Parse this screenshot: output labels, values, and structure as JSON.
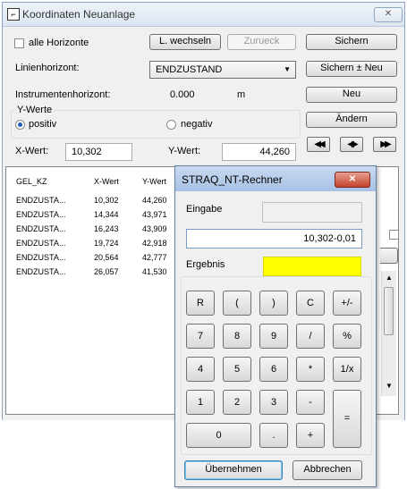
{
  "main": {
    "title": "Koordinaten Neuanlage",
    "close_icon": "✕",
    "alle_horizonte": "alle Horizonte",
    "l_wechseln": "L. wechseln",
    "zurueck": "Zurueck",
    "sichern": "Sichern",
    "linienhorizont_label": "Linienhorizont:",
    "linienhorizont_value": "ENDZUSTAND",
    "sichern_neu": "Sichern ± Neu",
    "instrumentenhorizont_label": "Instrumentenhorizont:",
    "instrumentenhorizont_value": "0.000",
    "instrumentenhorizont_unit": "m",
    "neu": "Neu",
    "y_werte": "Y-Werte",
    "positiv": "positiv",
    "negativ": "negativ",
    "aendern": "Ändern",
    "x_wert_label": "X-Wert:",
    "x_wert_value": "10,302",
    "y_wert_label": "Y-Wert:",
    "y_wert_value": "44,260",
    "nav_first": "◀◀",
    "nav_mid": "◀▶",
    "nav_last": "▶▶"
  },
  "table": {
    "headers": [
      "GEL_KZ",
      "X-Wert",
      "Y-Wert"
    ],
    "rows": [
      [
        "ENDZUSTA...",
        "10,302",
        "44,260"
      ],
      [
        "ENDZUSTA...",
        "14,344",
        "43,971"
      ],
      [
        "ENDZUSTA...",
        "16,243",
        "43,909"
      ],
      [
        "ENDZUSTA...",
        "19,724",
        "42,918"
      ],
      [
        "ENDZUSTA...",
        "20,564",
        "42,777"
      ],
      [
        "ENDZUSTA...",
        "26,057",
        "41,530"
      ]
    ]
  },
  "calc": {
    "title": "STRAQ_NT-Rechner",
    "close": "✕",
    "eingabe_label": "Eingabe",
    "eingabe_value": "",
    "expression": "10,302-0,01",
    "ergebnis_label": "Ergebnis",
    "ergebnis_value": "",
    "highlight_color": "#ffff00",
    "keys": {
      "r": "R",
      "lpar": "(",
      "rpar": ")",
      "c": "C",
      "pm": "+/-",
      "k7": "7",
      "k8": "8",
      "k9": "9",
      "div": "/",
      "pct": "%",
      "k4": "4",
      "k5": "5",
      "k6": "6",
      "mul": "*",
      "inv": "1/x",
      "k1": "1",
      "k2": "2",
      "k3": "3",
      "minus": "-",
      "eq": "=",
      "k0": "0",
      "dot": ".",
      "plus": "+"
    },
    "uebernehmen": "Übernehmen",
    "abbrechen": "Abbrechen"
  }
}
